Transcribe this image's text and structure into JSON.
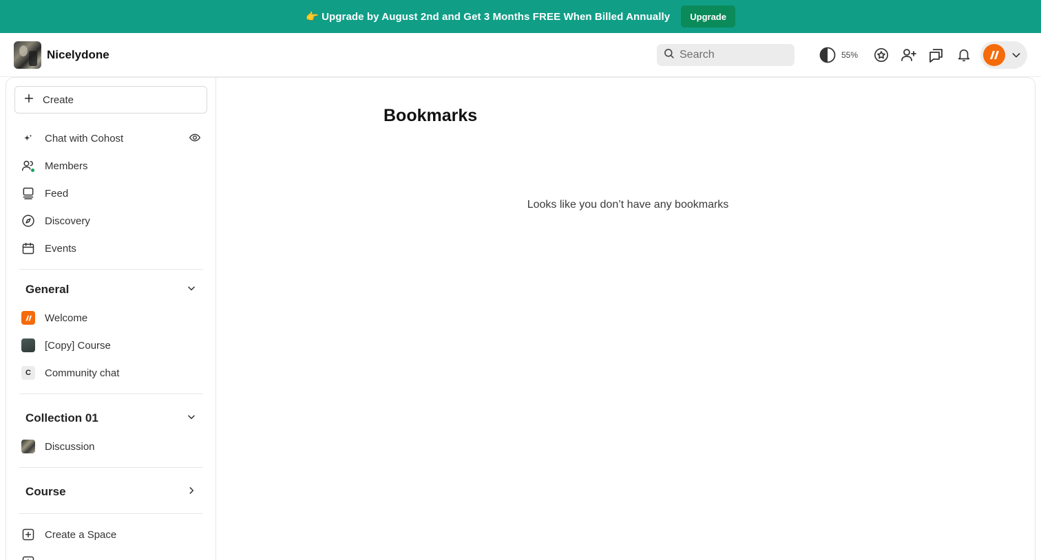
{
  "banner": {
    "text": "👉 Upgrade by August 2nd and Get 3 Months FREE When Billed Annually",
    "button_label": "Upgrade"
  },
  "header": {
    "community_name": "Nicelydone",
    "search_placeholder": "Search",
    "contrast_percent": "55%"
  },
  "sidebar": {
    "create_label": "Create",
    "nav": [
      {
        "label": "Chat with Cohost",
        "icon": "sparkle-icon"
      },
      {
        "label": "Members",
        "icon": "members-icon"
      },
      {
        "label": "Feed",
        "icon": "feed-icon"
      },
      {
        "label": "Discovery",
        "icon": "compass-icon"
      },
      {
        "label": "Events",
        "icon": "calendar-icon"
      }
    ],
    "sections": [
      {
        "title": "General",
        "expanded": true,
        "items": [
          {
            "label": "Welcome"
          },
          {
            "label": "[Copy] Course"
          },
          {
            "label": "Community chat",
            "letter": "C"
          }
        ]
      },
      {
        "title": "Collection 01",
        "expanded": true,
        "items": [
          {
            "label": "Discussion"
          }
        ]
      },
      {
        "title": "Course",
        "expanded": false,
        "items": []
      }
    ],
    "create_space_label": "Create a Space"
  },
  "main": {
    "title": "Bookmarks",
    "empty_message": "Looks like you don’t have any bookmarks"
  },
  "colors": {
    "banner": "#109e87",
    "upgrade_button": "#0b8a5a",
    "brand_orange": "#f56a0a",
    "online": "#14a35b"
  }
}
